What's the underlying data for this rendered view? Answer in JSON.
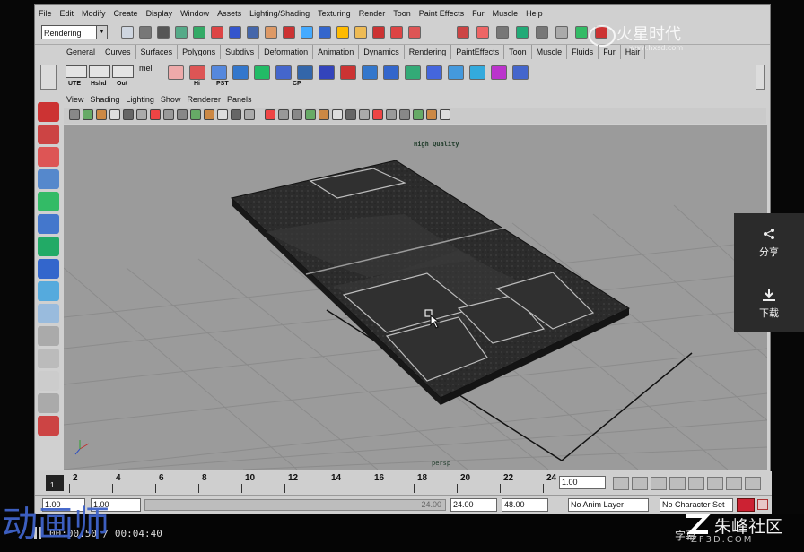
{
  "menu": [
    "File",
    "Edit",
    "Modify",
    "Create",
    "Display",
    "Window",
    "Assets",
    "Lighting/Shading",
    "Texturing",
    "Render",
    "Toon",
    "Paint Effects",
    "Fur",
    "Muscle",
    "Help"
  ],
  "mode_dropdown": "Rendering",
  "shelf_tabs": [
    "General",
    "Curves",
    "Surfaces",
    "Polygons",
    "Subdivs",
    "Deformation",
    "Animation",
    "Dynamics",
    "Rendering",
    "PaintEffects",
    "Toon",
    "Muscle",
    "Fluids",
    "Fur",
    "Hair"
  ],
  "shelf_labels": [
    "UTE",
    "Hshd",
    "Out",
    "mel",
    "Hi",
    "PST",
    "CP"
  ],
  "watermark_top": {
    "main": "火星时代",
    "sub": "www.hxsd.com"
  },
  "viewport_menu": [
    "View",
    "Shading",
    "Lighting",
    "Show",
    "Renderer",
    "Panels"
  ],
  "viewport": {
    "quality_label": "High Quality",
    "camera": "persp"
  },
  "timeline_ticks": [
    "2",
    "4",
    "6",
    "8",
    "10",
    "12",
    "14",
    "16",
    "18",
    "20",
    "22",
    "24"
  ],
  "current_frame": "1",
  "current_time_field": "1.00",
  "range": {
    "start": "1.00",
    "inner_start": "1.00",
    "slider_end": "24.00",
    "inner_end": "24.00",
    "end": "48.00"
  },
  "anim_layer": "No Anim Layer",
  "character_set": "No Character Set",
  "side_panel": [
    {
      "label": "分享",
      "icon": "share-icon"
    },
    {
      "label": "下载",
      "icon": "download-icon"
    }
  ],
  "player": {
    "time": "00:00:50 / 00:04:40",
    "subtitle_btn": "字幕"
  },
  "watermark_left": "动画师",
  "brand_text": "朱峰社区",
  "brand_url": "ZF3D.COM",
  "colors": {
    "viewport": "#9b9b9b",
    "ui": "#d0d0d0",
    "watermark": "#3f63c9"
  }
}
